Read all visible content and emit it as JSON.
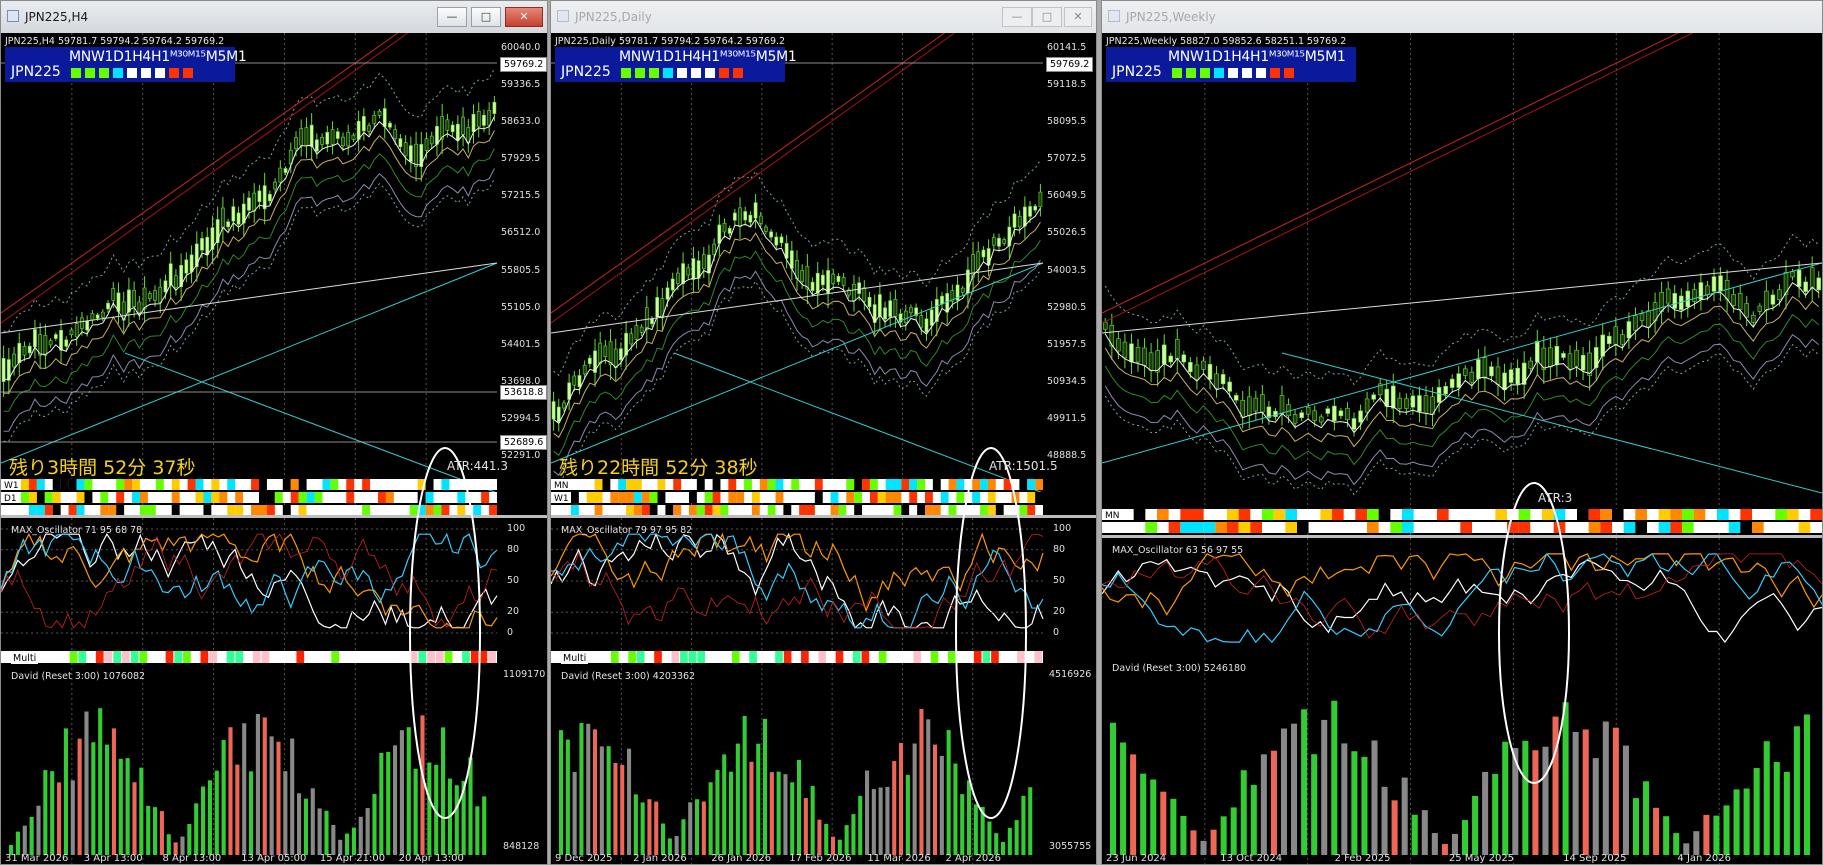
{
  "windows": [
    {
      "id": "h4",
      "title": "JPN225,H4",
      "active": true,
      "ohlc": "JPN225,H4  59781.7 59794.2 59764.2 59769.2",
      "symbol": "JPN225",
      "tf_row": "MNW1D1H4H1ᴹ³⁰ᴹ¹⁵M5M1",
      "tf_colors": [
        "#66ff00",
        "#66ff00",
        "#66ff00",
        "#00e5ff",
        "#ffffff",
        "#ffffff",
        "#ffffff",
        "#ff3300",
        "#ff3300"
      ],
      "price_labels": [
        "60040.0",
        "59336.5",
        "58633.0",
        "57929.5",
        "57215.5",
        "56512.0",
        "55805.5",
        "55105.0",
        "54401.5",
        "53698.0",
        "52994.5",
        "52291.0"
      ],
      "current_price": "59769.2",
      "extra_price_labels": [
        "53618.8",
        "52689.6"
      ],
      "remaining": "残り3時間 52分 37秒",
      "atr": "ATR:441.3",
      "bar_labels": [
        "W1",
        "D1",
        ""
      ],
      "osc_label": "MAX_Oscillator 71 95 68 78",
      "osc_levels": [
        "100",
        "80",
        "50",
        "20",
        "0"
      ],
      "multi_label": "Multi",
      "david_label": "David (Reset 3:00) 1076082",
      "david_levels": [
        "1109170",
        "848128"
      ],
      "dates": [
        "31 Mar 2026",
        "3 Apr 13:00",
        "8 Apr 13:00",
        "13 Apr 05:00",
        "15 Apr 21:00",
        "20 Apr 13:00"
      ]
    },
    {
      "id": "d1",
      "title": "JPN225,Daily",
      "active": false,
      "ohlc": "JPN225,Daily  59781.7 59794.2 59764.2 59769.2",
      "symbol": "JPN225",
      "tf_row": "MNW1D1H4H1ᴹ³⁰ᴹ¹⁵M5M1",
      "tf_colors": [
        "#66ff00",
        "#66ff00",
        "#66ff00",
        "#00e5ff",
        "#ffffff",
        "#ffffff",
        "#ffffff",
        "#ff3300",
        "#ff3300"
      ],
      "price_labels": [
        "60141.5",
        "59118.5",
        "58095.5",
        "57072.5",
        "56049.5",
        "55026.5",
        "54003.5",
        "52980.5",
        "51957.5",
        "50934.5",
        "49911.5",
        "48888.5"
      ],
      "current_price": "59769.2",
      "extra_price_labels": [],
      "remaining": "残り22時間 52分 38秒",
      "atr": "ATR:1501.5",
      "bar_labels": [
        "MN",
        "W1",
        ""
      ],
      "osc_label": "MAX_Oscillator 79 97 95 82",
      "osc_levels": [
        "100",
        "80",
        "50",
        "20",
        "0"
      ],
      "multi_label": "Multi",
      "david_label": "David (Reset 3:00) 4203362",
      "david_levels": [
        "4516926",
        "3055755"
      ],
      "dates": [
        "9 Dec 2025",
        "2 Jan 2026",
        "26 Jan 2026",
        "17 Feb 2026",
        "11 Mar 2026",
        "2 Apr 2026"
      ]
    },
    {
      "id": "w1",
      "title": "JPN225,Weekly",
      "active": false,
      "ohlc": "JPN225,Weekly  58827.0 59852.6 58251.1 59769.2",
      "symbol": "JPN225",
      "tf_row": "MNW1D1H4H1ᴹ³⁰ᴹ¹⁵M5M1",
      "tf_colors": [
        "#66ff00",
        "#66ff00",
        "#66ff00",
        "#00e5ff",
        "#ffffff",
        "#ffffff",
        "#ffffff",
        "#ff3300",
        "#ff3300"
      ],
      "price_labels": [],
      "current_price": "",
      "extra_price_labels": [],
      "remaining": "",
      "atr": "ATR:3",
      "bar_labels": [
        "MN",
        ""
      ],
      "osc_label": "MAX_Oscillator 63 56 97 55",
      "osc_levels": [],
      "multi_label": "",
      "david_label": "David (Reset 3:00) 5246180",
      "david_levels": [],
      "dates": [
        "23 Jun 2024",
        "13 Oct 2024",
        "2 Feb 2025",
        "25 May 2025",
        "14 Sep 2025",
        "4 Jan 2026"
      ]
    }
  ],
  "controls": {
    "minimize": "—",
    "maximize": "□",
    "close": "✕"
  }
}
